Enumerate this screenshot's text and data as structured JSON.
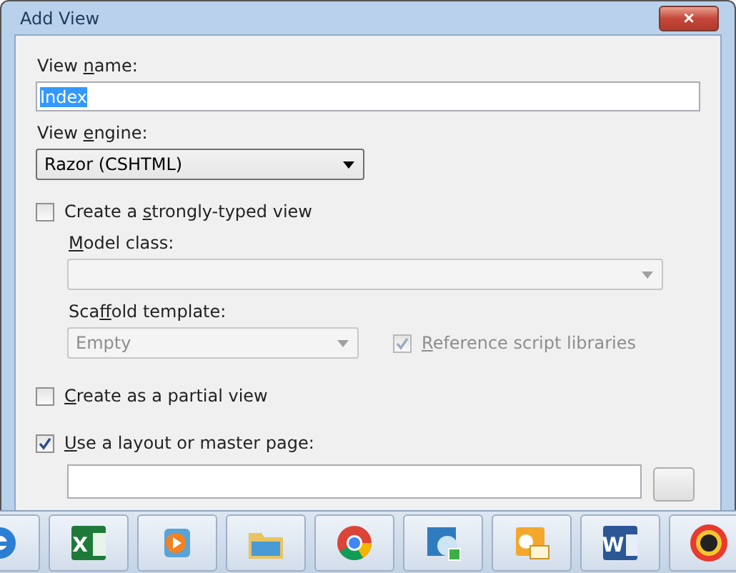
{
  "window": {
    "title": "Add View",
    "close_label": "×"
  },
  "view_name": {
    "label": {
      "pre": "View ",
      "key": "n",
      "post": "ame:"
    },
    "value": "Index",
    "selected_text": true
  },
  "view_engine": {
    "label": {
      "pre": "View ",
      "key": "e",
      "post": "ngine:"
    },
    "value": "Razor (CSHTML)",
    "disabled": false
  },
  "options": [
    {
      "kind": "checkbox",
      "label": {
        "pre": "Create a ",
        "key": "s",
        "post": "trongly-typed view"
      },
      "checked": false
    },
    {
      "kind": "label",
      "label": {
        "key": "M",
        "post": "odel class:"
      }
    },
    {
      "kind": "select",
      "disabled": true
    },
    {
      "kind": "label",
      "label": {
        "pre": "Sca",
        "key": "f",
        "post": "fold template:"
      }
    },
    {
      "kind": "select-check",
      "value": "Empty",
      "disabled": true,
      "check": {
        "label": {
          "key": "R",
          "post": "eference script libraries"
        },
        "checked": true,
        "disabled": true
      }
    },
    {
      "kind": "checkbox",
      "label": {
        "key": "C",
        "post": "reate as a partial view"
      },
      "checked": false
    },
    {
      "kind": "checkbox",
      "label": {
        "key": "U",
        "post": "se a layout or master page:"
      },
      "checked": true
    },
    {
      "kind": "field-button"
    }
  ],
  "taskbar": [
    {
      "kind": "ie"
    },
    {
      "kind": "excel",
      "glyph": "X"
    },
    {
      "kind": "media"
    },
    {
      "kind": "folder"
    },
    {
      "kind": "chrome"
    },
    {
      "kind": "lync"
    },
    {
      "kind": "outlook"
    },
    {
      "kind": "word",
      "glyph": "W"
    },
    {
      "kind": "badge"
    }
  ]
}
